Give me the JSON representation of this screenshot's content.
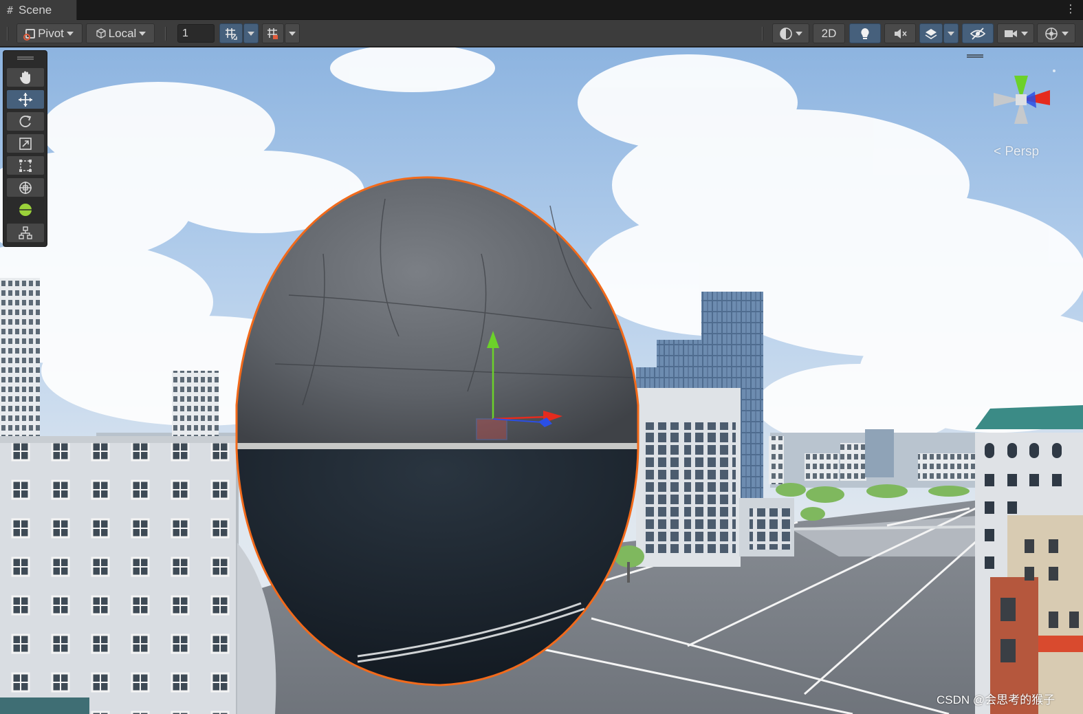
{
  "window": {
    "tab_label": "Scene",
    "tab_icon": "grid-hash-icon"
  },
  "toolbar": {
    "pivot_label": "Pivot",
    "local_label": "Local",
    "increment_value": "1",
    "view_2d_label": "2D"
  },
  "viewport": {
    "camera_label": "< Persp",
    "watermark": "CSDN @会思考的猴子"
  },
  "tools": [
    "hand-tool",
    "move-tool",
    "rotate-tool",
    "scale-tool",
    "rect-tool",
    "transform-tool",
    "custom-editor-tool",
    "component-tool"
  ],
  "colors": {
    "selection_outline": "#f26a1b",
    "active_tool": "#46607c",
    "axis_x": "#e52b1e",
    "axis_y": "#6cd12a",
    "axis_z": "#2a4fe5"
  }
}
